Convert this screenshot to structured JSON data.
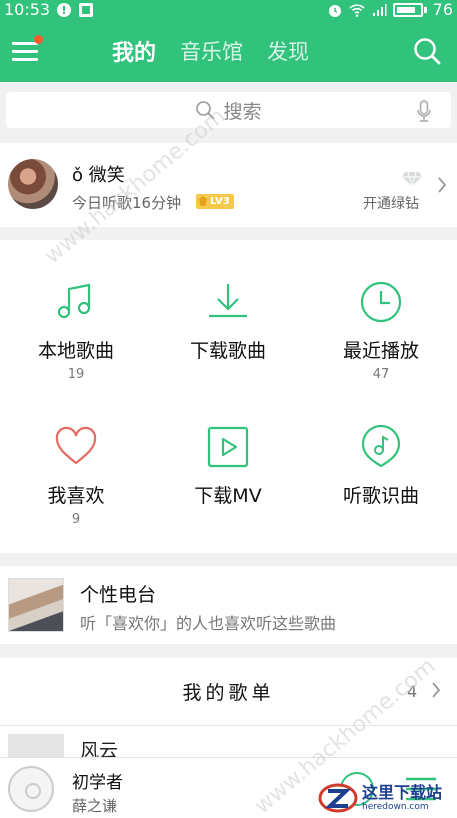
{
  "status_bar": {
    "time": "10:53",
    "battery": "76"
  },
  "header": {
    "tabs": [
      {
        "label": "我的",
        "active": true
      },
      {
        "label": "音乐馆",
        "active": false
      },
      {
        "label": "发现",
        "active": false
      }
    ]
  },
  "search": {
    "placeholder": "搜索"
  },
  "profile": {
    "nickname": "ǒ  微笑",
    "listen_time": "今日听歌16分钟",
    "level": "LV3",
    "green_diamond_label": "开通绿钻"
  },
  "shortcuts": [
    {
      "label": "本地歌曲",
      "count": "19",
      "icon": "music-note-icon"
    },
    {
      "label": "下载歌曲",
      "count": "",
      "icon": "download-icon"
    },
    {
      "label": "最近播放",
      "count": "47",
      "icon": "clock-icon"
    },
    {
      "label": "我喜欢",
      "count": "9",
      "icon": "heart-icon"
    },
    {
      "label": "下载MV",
      "count": "",
      "icon": "video-play-icon"
    },
    {
      "label": "听歌识曲",
      "count": "",
      "icon": "music-recognize-icon"
    }
  ],
  "radio": {
    "title": "个性电台",
    "subtitle": "听「喜欢你」的人也喜欢听这些歌曲"
  },
  "playlist": {
    "title": "我的歌单",
    "count": "4"
  },
  "first_song": {
    "title": "风云"
  },
  "player": {
    "title": "初学者",
    "artist": "薛之谦"
  },
  "watermark": {
    "site_cn": "这里下载站",
    "site_en": "heredown.com",
    "diagonal": "www.hackhome.com"
  },
  "colors": {
    "accent": "#31c27c",
    "notification_dot": "#ff5a2b",
    "heart": "#e36b64",
    "level_badge": "#f7c94a"
  }
}
